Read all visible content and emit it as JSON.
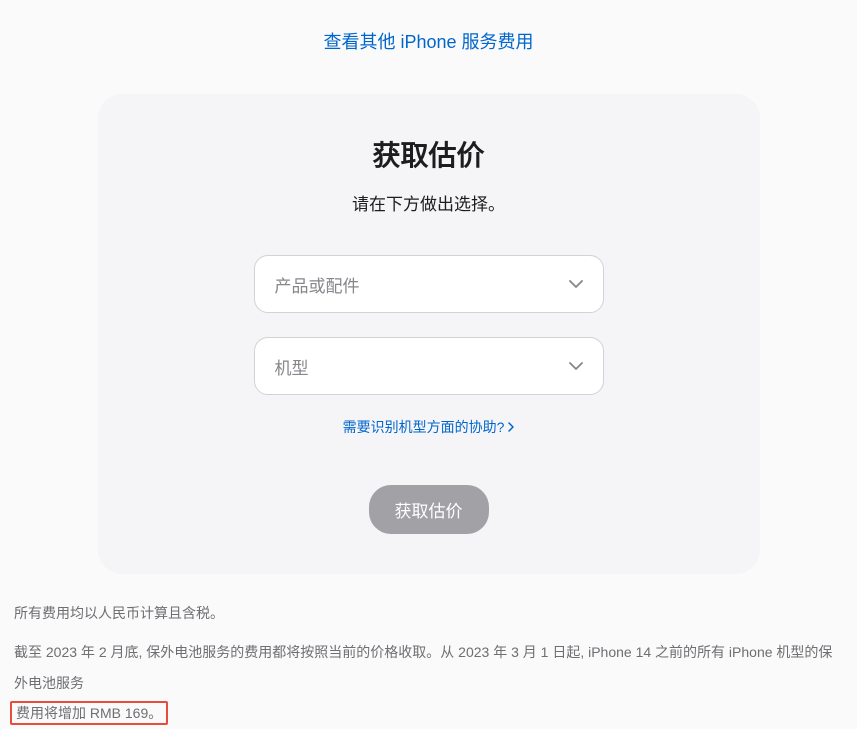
{
  "topLink": {
    "label": "查看其他 iPhone 服务费用"
  },
  "card": {
    "title": "获取估价",
    "subtitle": "请在下方做出选择。",
    "select1": {
      "placeholder": "产品或配件"
    },
    "select2": {
      "placeholder": "机型"
    },
    "helpLink": "需要识别机型方面的协助?",
    "submitLabel": "获取估价"
  },
  "footer": {
    "line1": "所有费用均以人民币计算且含税。",
    "line2_part1": "截至 2023 年 2 月底, 保外电池服务的费用都将按照当前的价格收取。从 2023 年 3 月 1 日起, iPhone 14 之前的所有 iPhone 机型的保外电池服务",
    "line2_part2": "费用将增加 RMB 169。"
  }
}
